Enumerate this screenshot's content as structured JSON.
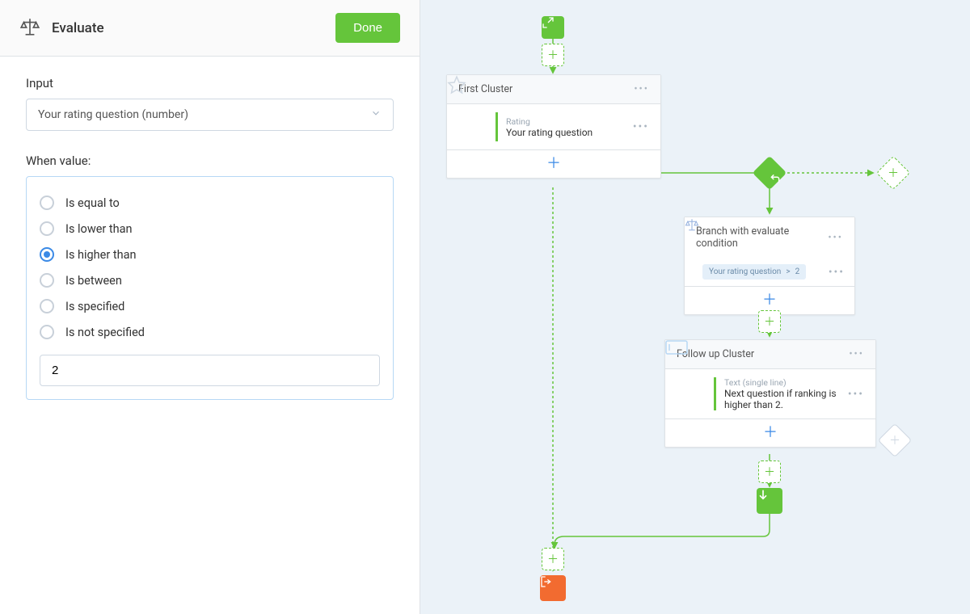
{
  "panel": {
    "title": "Evaluate",
    "done_label": "Done",
    "input_label": "Input",
    "input_value": "Your rating question (number)",
    "when_label": "When value:",
    "options": [
      {
        "key": "eq",
        "label": "Is equal to",
        "selected": false
      },
      {
        "key": "lt",
        "label": "Is lower than",
        "selected": false
      },
      {
        "key": "gt",
        "label": "Is higher than",
        "selected": true
      },
      {
        "key": "bt",
        "label": "Is between",
        "selected": false
      },
      {
        "key": "sp",
        "label": "Is specified",
        "selected": false
      },
      {
        "key": "ns",
        "label": "Is not specified",
        "selected": false
      }
    ],
    "value": "2"
  },
  "flow": {
    "cluster1": {
      "title": "First Cluster",
      "q_type": "Rating",
      "q_text": "Your rating question"
    },
    "branch": {
      "title": "Branch with evaluate condition",
      "expr_left": "Your rating question",
      "expr_op": ">",
      "expr_right": "2"
    },
    "cluster2": {
      "title": "Follow up Cluster",
      "q_type": "Text (single line)",
      "q_text": "Next question if ranking is higher than 2."
    }
  },
  "colors": {
    "accent": "#65c53b",
    "blue": "#3b8ae6",
    "orange": "#f26b30"
  }
}
